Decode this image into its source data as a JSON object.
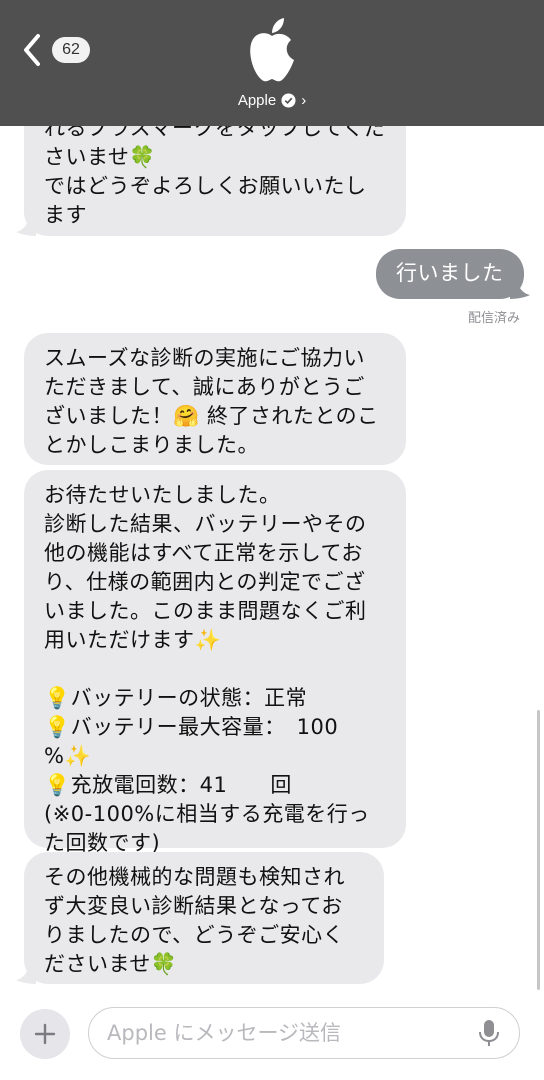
{
  "header": {
    "unread_count": "62",
    "contact_name": "Apple",
    "back_icon": "chevron-left-icon",
    "logo_icon": "apple-logo-icon"
  },
  "messages": [
    {
      "direction": "in",
      "text": "れるプラスマークをタップしてくださいませ🍀\nではどうぞよろしくお願いいたします"
    },
    {
      "direction": "out",
      "text": "行いました"
    },
    {
      "direction": "in",
      "text": "スムーズな診断の実施にご協力いただきまして、誠にありがとうございました！🤗 終了されたとのことかしこまりました。"
    },
    {
      "direction": "in",
      "text": "お待たせいたしました。\n診断した結果、バッテリーやその他の機能はすべて正常を示しており、仕様の範囲内との判定でございました。このまま問題なくご利用いただけます✨\n\n💡バッテリーの状態：正常\n💡バッテリー最大容量：　100　%✨\n💡充放電回数：41　　回\n(※0-100%に相当する充電を行った回数です)"
    },
    {
      "direction": "in",
      "text": "その他機械的な問題も検知されず大変良い診断結果となっておりましたので、どうぞご安心くださいませ🍀"
    }
  ],
  "status": {
    "delivered": "配信済み"
  },
  "composer": {
    "placeholder": "Apple にメッセージ送信"
  },
  "colors": {
    "header_bg": "#505050",
    "incoming_bubble": "#e9e9eb",
    "outgoing_bubble": "#8d9196"
  }
}
